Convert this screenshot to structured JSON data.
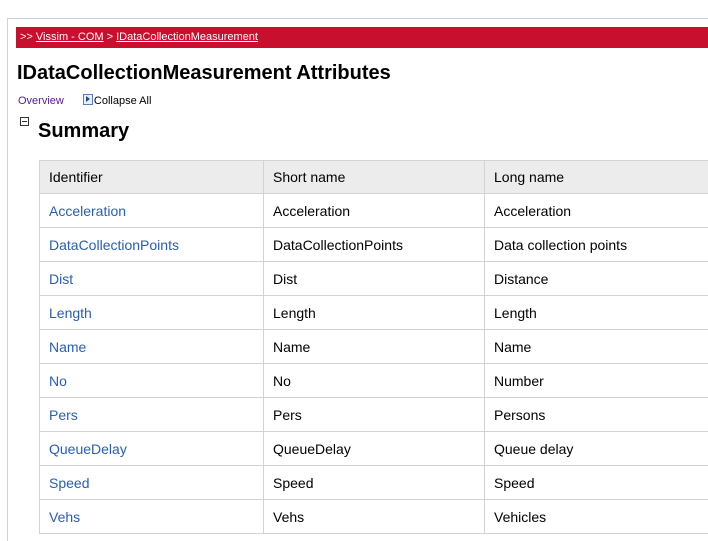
{
  "breadcrumb": {
    "prefix": ">>",
    "items": [
      "Vissim - COM",
      "IDataCollectionMeasurement"
    ],
    "separator": ">"
  },
  "page_title": "IDataCollectionMeasurement Attributes",
  "subnav": {
    "overview": "Overview",
    "collapse_all": "Collapse All"
  },
  "summary": {
    "title": "Summary",
    "columns": [
      "Identifier",
      "Short name",
      "Long name"
    ],
    "rows": [
      [
        "Acceleration",
        "Acceleration",
        "Acceleration"
      ],
      [
        "DataCollectionPoints",
        "DataCollectionPoints",
        "Data collection points"
      ],
      [
        "Dist",
        "Dist",
        "Distance"
      ],
      [
        "Length",
        "Length",
        "Length"
      ],
      [
        "Name",
        "Name",
        "Name"
      ],
      [
        "No",
        "No",
        "Number"
      ],
      [
        "Pers",
        "Pers",
        "Persons"
      ],
      [
        "QueueDelay",
        "QueueDelay",
        "Queue delay"
      ],
      [
        "Speed",
        "Speed",
        "Speed"
      ],
      [
        "Vehs",
        "Vehs",
        "Vehicles"
      ]
    ]
  },
  "colors": {
    "breadcrumb_bg": "#c8102e",
    "link": "#2a5db0",
    "visited_link": "#551a8b",
    "header_bg": "#ececec"
  },
  "icons": {
    "collapse_all": "collapse-arrow-icon",
    "section_toggle": "minus-box-icon"
  }
}
